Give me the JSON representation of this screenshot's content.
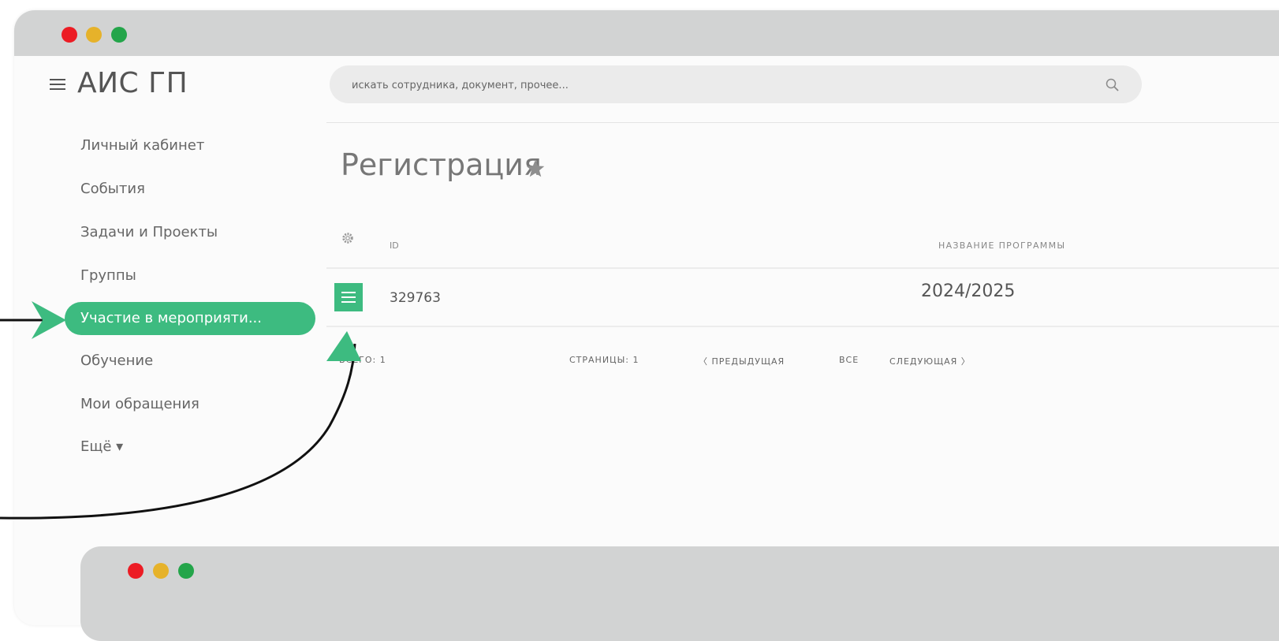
{
  "app": {
    "logo": "АИС ГП"
  },
  "search": {
    "placeholder": "искать сотрудника, документ, прочее..."
  },
  "sidebar": {
    "items": [
      {
        "label": "Личный кабинет"
      },
      {
        "label": "События"
      },
      {
        "label": "Задачи и Проекты"
      },
      {
        "label": "Группы"
      },
      {
        "label": "Участие в мероприяти...",
        "active": true
      },
      {
        "label": "Обучение"
      },
      {
        "label": "Мои обращения"
      },
      {
        "label": "Ещё ▾"
      }
    ]
  },
  "main": {
    "title": "Регистрация",
    "table": {
      "columns": [
        "ID",
        "НАЗВАНИЕ ПРОГРАММЫ"
      ],
      "rows": [
        {
          "id": "329763",
          "name": "2024/2025"
        }
      ]
    },
    "footer": {
      "total": "ВСЕГО: 1",
      "pages": "СТРАНИЦЫ: 1",
      "prev": "ПРЕДЫДУЩАЯ",
      "all": "ВСЕ",
      "next": "СЛЕДУЮЩАЯ"
    }
  },
  "colors": {
    "accent": "#3dbb80",
    "titlebar": "#d2d3d3",
    "dot_red": "#ec1c24",
    "dot_yellow": "#e6b22a",
    "dot_green": "#24a54a"
  }
}
